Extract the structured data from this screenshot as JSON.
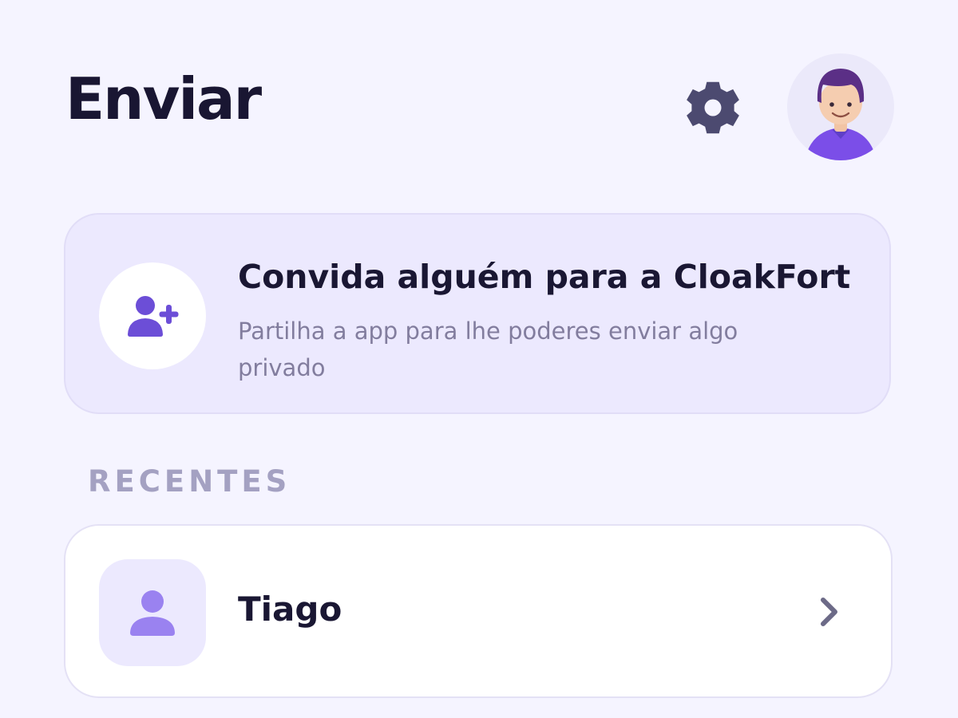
{
  "header": {
    "title": "Enviar",
    "settings_icon": "gear-icon",
    "avatar_icon": "user-avatar-icon"
  },
  "invite_card": {
    "icon": "user-plus-icon",
    "title": "Convida alguém para a CloakFort",
    "subtitle": "Partilha a app para lhe poderes enviar algo privado"
  },
  "recent": {
    "section_label": "RECENTES",
    "contacts": [
      {
        "name": "Tiago",
        "icon": "person-icon",
        "action_icon": "chevron-right-icon"
      }
    ]
  },
  "colors": {
    "background": "#f5f4ff",
    "accent": "#7452e8",
    "text_primary": "#191632",
    "text_secondary": "#827d9e",
    "section_label": "#a4a1c2",
    "settings_icon": "#4c4a70"
  }
}
